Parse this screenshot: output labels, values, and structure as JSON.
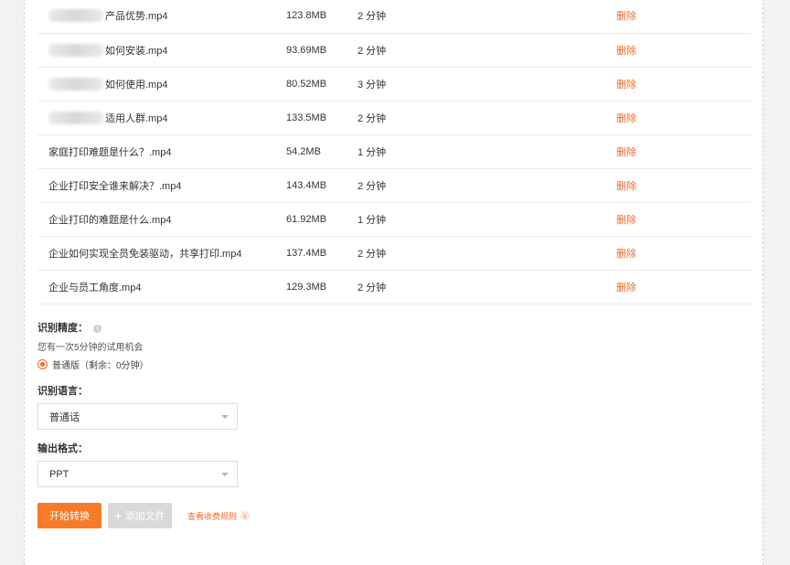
{
  "files": [
    {
      "name": "产品优势.mp4",
      "size": "123.8MB",
      "duration": "2 分钟",
      "action": "删除",
      "blurred_prefix": true
    },
    {
      "name": "如何安装.mp4",
      "size": "93.69MB",
      "duration": "2 分钟",
      "action": "删除",
      "blurred_prefix": true
    },
    {
      "name": "如何使用.mp4",
      "size": "80.52MB",
      "duration": "3 分钟",
      "action": "删除",
      "blurred_prefix": true
    },
    {
      "name": "适用人群.mp4",
      "size": "133.5MB",
      "duration": "2 分钟",
      "action": "删除",
      "blurred_prefix": true
    },
    {
      "name": "家庭打印难题是什么？.mp4",
      "size": "54.2MB",
      "duration": "1 分钟",
      "action": "删除",
      "blurred_prefix": false
    },
    {
      "name": "企业打印安全谁来解决？.mp4",
      "size": "143.4MB",
      "duration": "2 分钟",
      "action": "删除",
      "blurred_prefix": false
    },
    {
      "name": "企业打印的难题是什么.mp4",
      "size": "61.92MB",
      "duration": "1 分钟",
      "action": "删除",
      "blurred_prefix": false
    },
    {
      "name": "企业如何实现全员免装驱动，共享打印.mp4",
      "size": "137.4MB",
      "duration": "2 分钟",
      "action": "删除",
      "blurred_prefix": false
    },
    {
      "name": "企业与员工角度.mp4",
      "size": "129.3MB",
      "duration": "2 分钟",
      "action": "删除",
      "blurred_prefix": false
    }
  ],
  "accuracy": {
    "label": "识别精度：",
    "hint": "您有一次5分钟的试用机会",
    "option": "普通版（剩余：0分钟）",
    "info_icon": "info-icon"
  },
  "language": {
    "label": "识别语言：",
    "selected": "普通话"
  },
  "format": {
    "label": "输出格式：",
    "selected": "PPT"
  },
  "actions": {
    "start": "开始转换",
    "add_file": "添加文件",
    "fee_rules": "查看收费规则"
  },
  "colors": {
    "accent": "#f97a26",
    "delete": "#f46a2a",
    "disabled": "#d9d9d9"
  }
}
